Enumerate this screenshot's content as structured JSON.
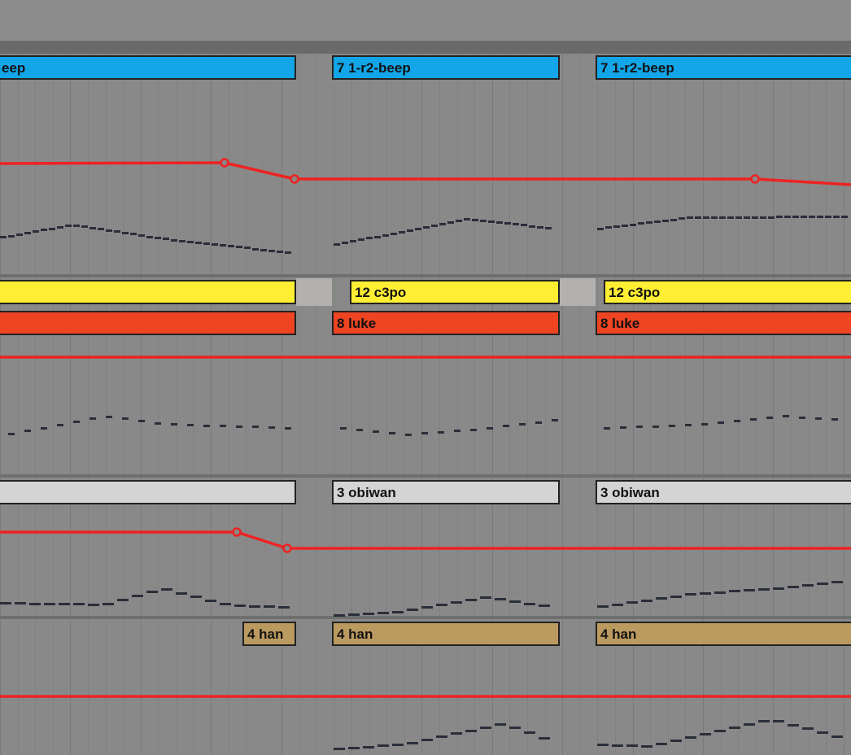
{
  "colors": {
    "beep": "#12a6e8",
    "c3po": "#ffee33",
    "luke": "#ee4422",
    "obiwan": "#d4d4d4",
    "han": "#bb9a60",
    "automation": "#ee2222",
    "notes": "#2a2e3a"
  },
  "tracks": [
    {
      "id": "r2",
      "clips": [
        {
          "label": "eep"
        },
        {
          "label": "7 1-r2-beep"
        },
        {
          "label": "7 1-r2-beep"
        }
      ]
    },
    {
      "id": "c3po",
      "clips": [
        {
          "label": ""
        },
        {
          "label": "12 c3po"
        },
        {
          "label": "12 c3po"
        }
      ]
    },
    {
      "id": "luke",
      "clips": [
        {
          "label": ""
        },
        {
          "label": "8 luke"
        },
        {
          "label": "8 luke"
        }
      ]
    },
    {
      "id": "obiwan",
      "clips": [
        {
          "label": ""
        },
        {
          "label": "3 obiwan"
        },
        {
          "label": "3 obiwan"
        }
      ]
    },
    {
      "id": "han",
      "clips": [
        {
          "label": "4 han"
        },
        {
          "label": "4 han"
        },
        {
          "label": "4 han"
        }
      ]
    }
  ]
}
